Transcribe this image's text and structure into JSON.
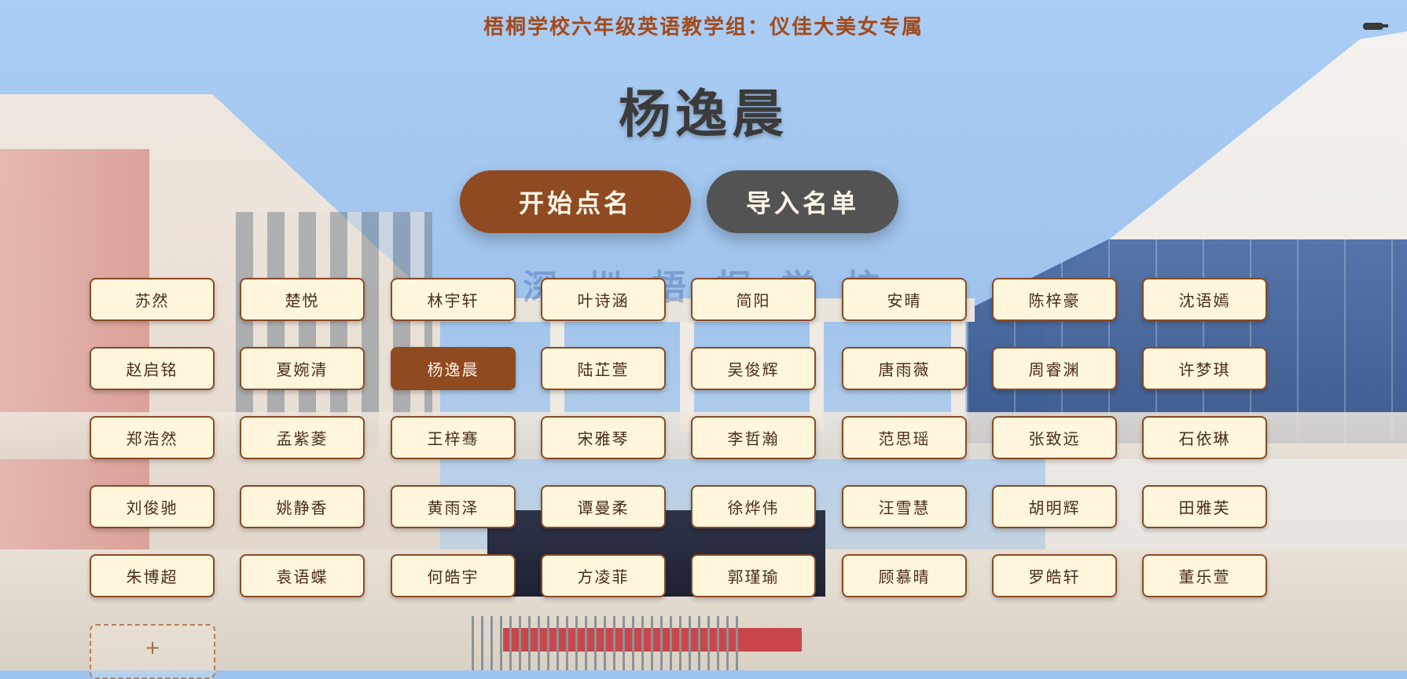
{
  "header": {
    "subtitle": "梧桐学校六年级英语教学组：仪佳大美女专属",
    "current_name": "杨逸晨"
  },
  "buttons": {
    "start": "开始点名",
    "import": "导入名单"
  },
  "background": {
    "watermark_text": "深圳梧桐学校"
  },
  "students": [
    "苏然",
    "楚悦",
    "林宇轩",
    "叶诗涵",
    "简阳",
    "安晴",
    "陈梓豪",
    "沈语嫣",
    "赵启铭",
    "夏婉清",
    "杨逸晨",
    "陆芷萱",
    "吴俊辉",
    "唐雨薇",
    "周睿渊",
    "许梦琪",
    "郑浩然",
    "孟紫菱",
    "王梓骞",
    "宋雅琴",
    "李哲瀚",
    "范思瑶",
    "张致远",
    "石依琳",
    "刘俊驰",
    "姚静香",
    "黄雨泽",
    "谭曼柔",
    "徐烨伟",
    "汪雪慧",
    "胡明辉",
    "田雅芙",
    "朱博超",
    "袁语蝶",
    "何皓宇",
    "方凌菲",
    "郭瑾瑜",
    "顾慕晴",
    "罗皓轩",
    "董乐萱"
  ],
  "selected_student": "杨逸晨",
  "add_card": {
    "label": "+"
  },
  "colors": {
    "accent": "#8f4a22",
    "card_bg": "#fff6dc",
    "card_border": "#8a4a25",
    "import_button": "#535353",
    "subtitle": "#a34a1a"
  }
}
